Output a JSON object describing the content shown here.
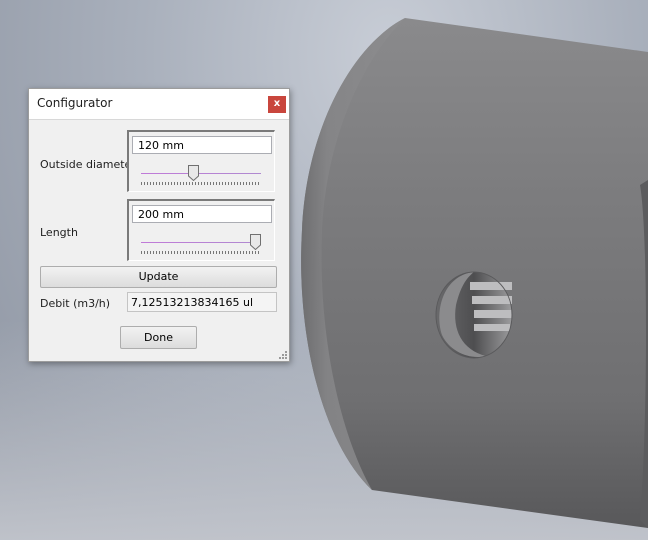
{
  "dialog": {
    "title": "Configurator",
    "close_label": "x",
    "outside_diameter": {
      "label": "Outside diameter",
      "value": "120 mm",
      "slider_fraction": 0.43
    },
    "length": {
      "label": "Length",
      "value": "200 mm",
      "slider_fraction": 1.0
    },
    "update_label": "Update",
    "debit": {
      "label": "Debit (m3/h)",
      "value": "7,12513213834165 ul"
    },
    "done_label": "Done"
  },
  "colors": {
    "close_button": "#c9463d",
    "slider_track": "#c07ad8",
    "model_body": "#7f7f81"
  }
}
